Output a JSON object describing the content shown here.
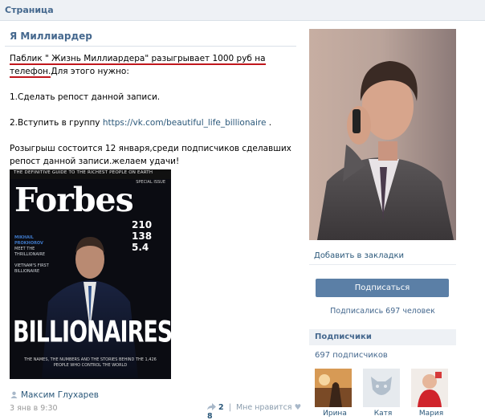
{
  "topbar": {
    "breadcrumb": "Страница"
  },
  "post": {
    "title": "Я Миллиардер",
    "line1_highlight": "Паблик \" Жизнь Миллиардера\" разыгрывает 1000 руб на телефон.",
    "line1_rest": "Для этого нужно:",
    "step1": "1.Сделать репост данной записи.",
    "step2_prefix": "2.Вступить в группу ",
    "step2_link": "https://vk.com/beautiful_life_billionaire",
    "step2_suffix": " .",
    "draw_text": "Розыгрыш состоится 12 января,среди подписчиков сделавших репост данной записи.желаем удачи!",
    "author": "Максим Глухарев",
    "date": "3 янв в 9:30",
    "reposts": "2",
    "like_label": "Мне нравится",
    "likes": "8"
  },
  "forbes_cover": {
    "tagline": "THE DEFINITIVE GUIDE TO THE RICHEST PEOPLE ON EARTH",
    "special": "SPECIAL ISSUE",
    "logo": "Forbes",
    "side_name": "MIKHAIL PROKHOROV",
    "side_text": "MEET THE THRILLIONAIRE",
    "side_text2": "VIETNAM'S FIRST BILLIONAIRE",
    "stats": [
      "210",
      "138",
      "5.4"
    ],
    "headline": "BILLIONAIRES",
    "subtitle": "THE NAMES, THE NUMBERS AND THE STORIES BEHIND THE 1,426 PEOPLE WHO CONTROL THE WORLD"
  },
  "sidebar": {
    "bookmark": "Добавить в закладки",
    "subscribe_button": "Подписаться",
    "subscribed_count": "Подписались 697 человек",
    "subscribers_title": "Подписчики",
    "subscribers_count": "697 подписчиков",
    "members": [
      {
        "name": "Ирина"
      },
      {
        "name": "Катя"
      },
      {
        "name": "Мария"
      }
    ]
  }
}
